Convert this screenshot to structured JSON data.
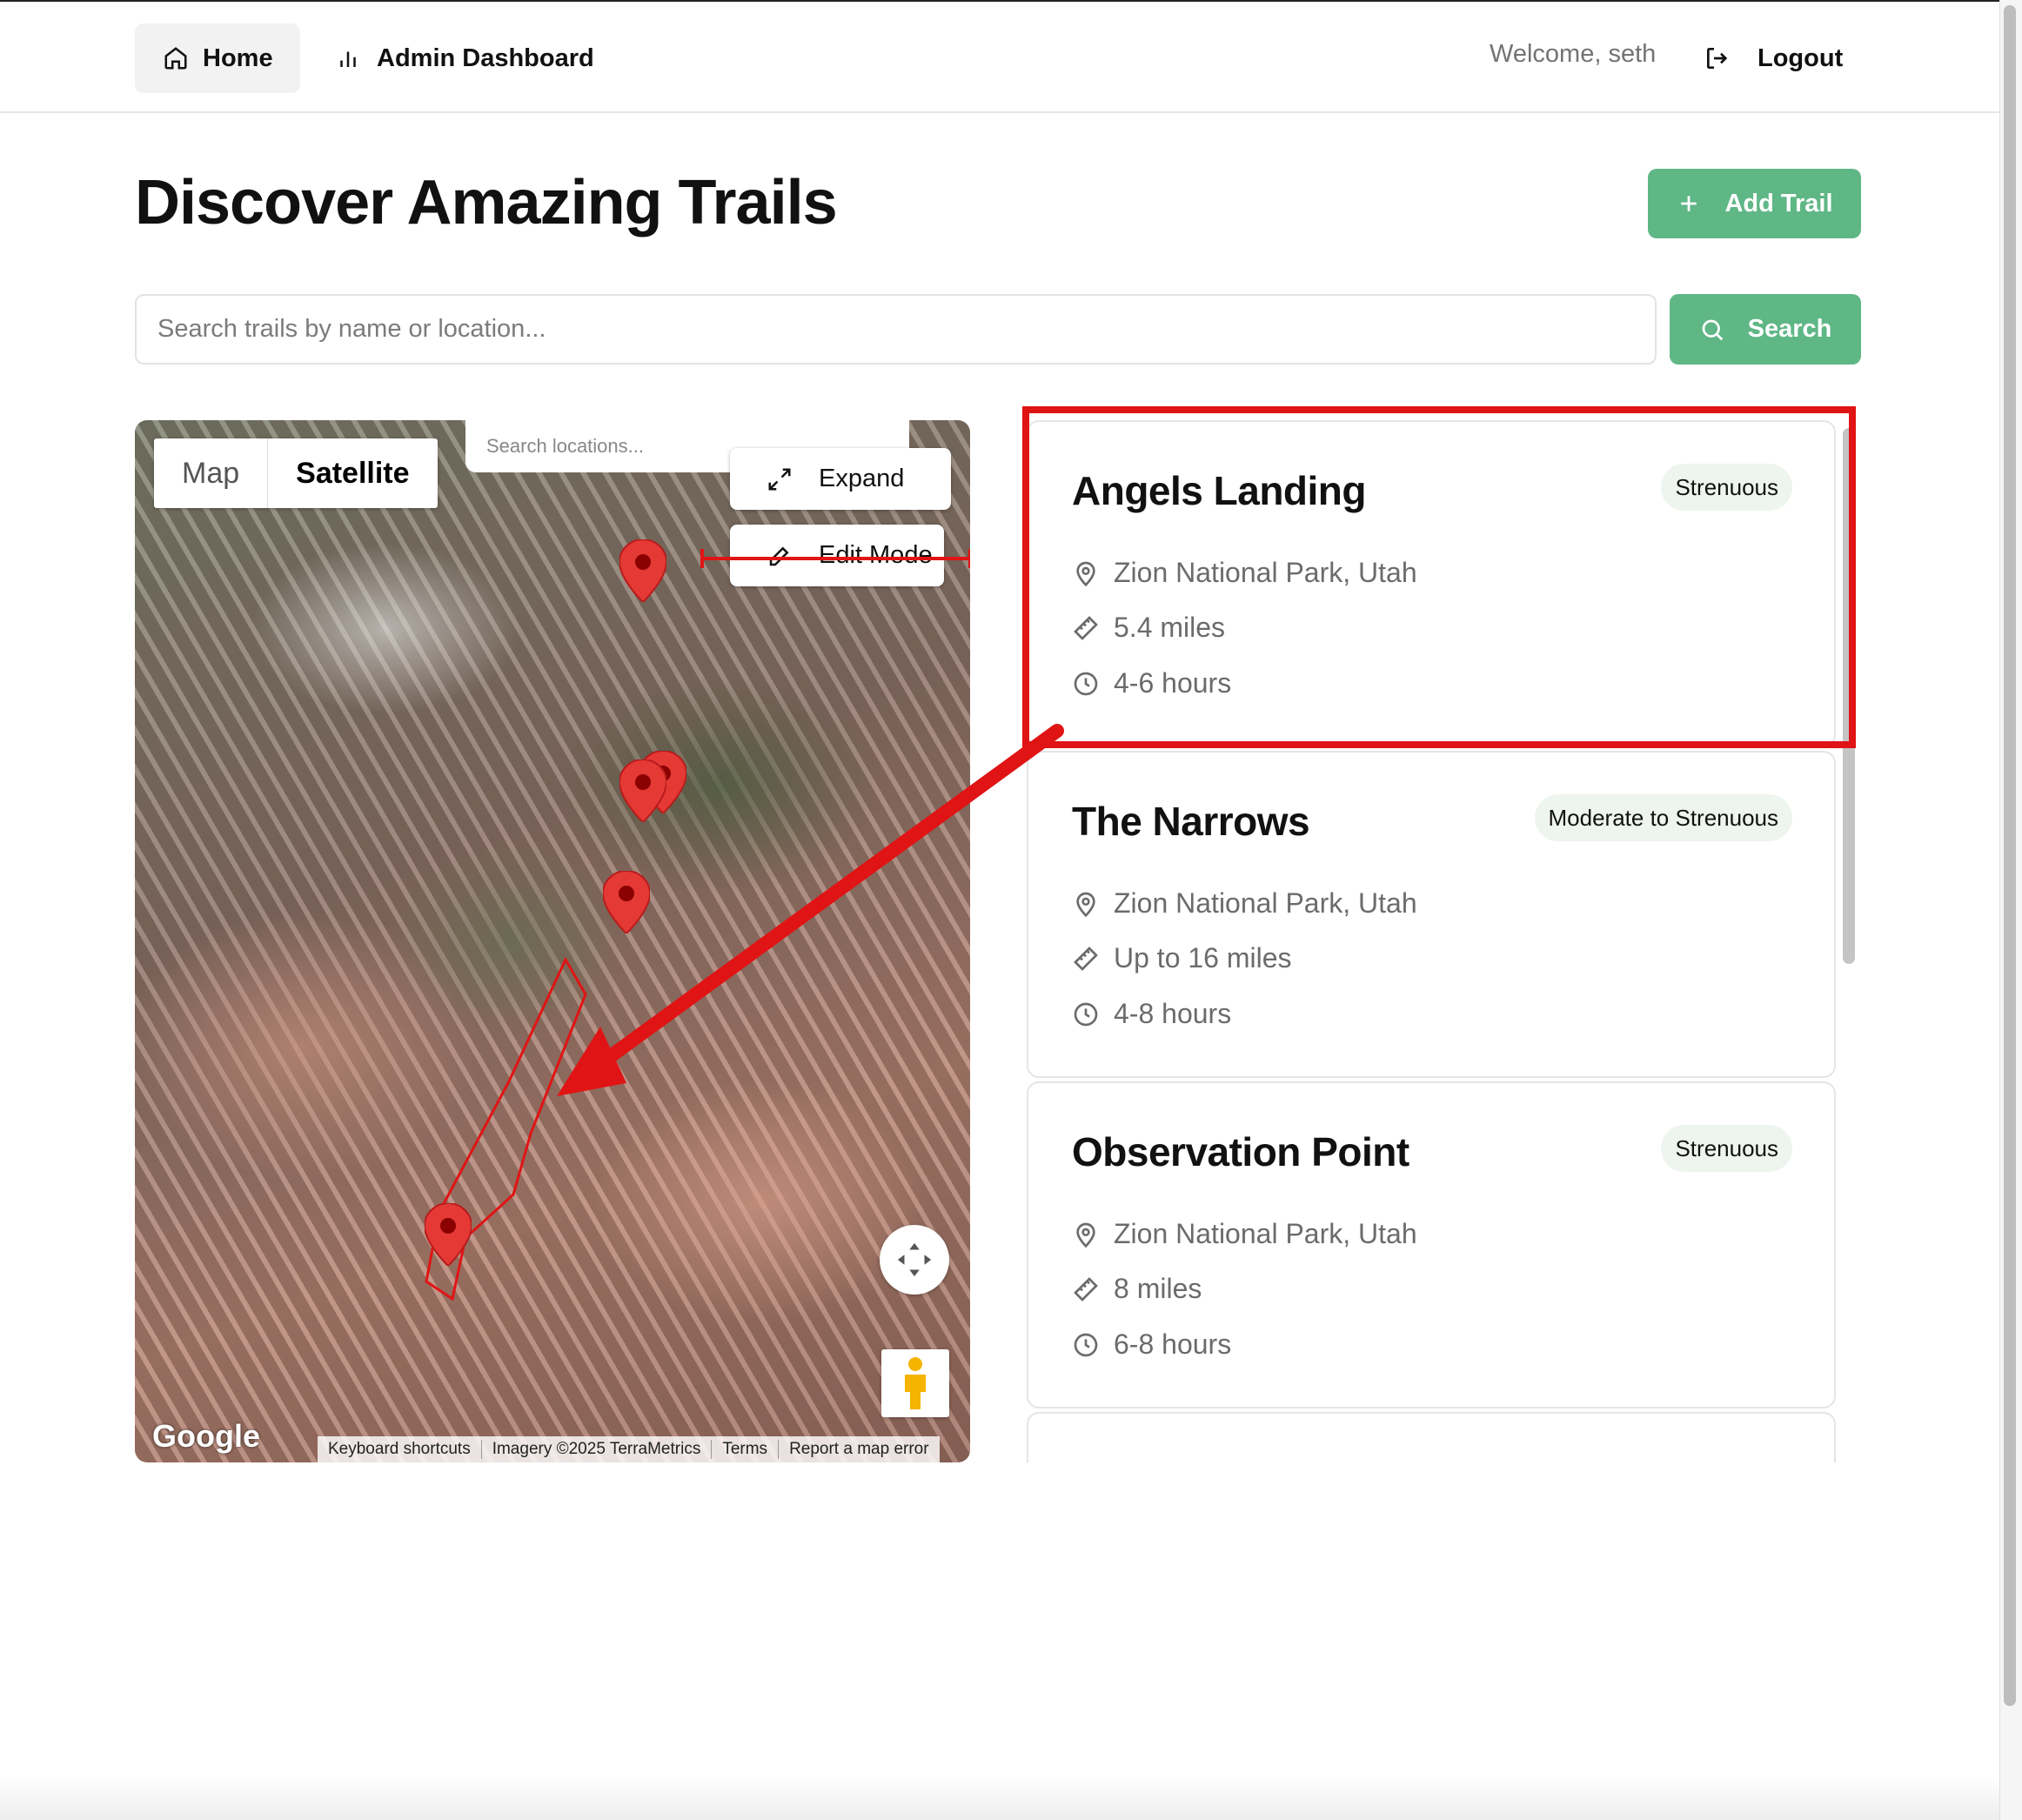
{
  "nav": {
    "home_label": "Home",
    "admin_label": "Admin Dashboard",
    "welcome_text": "Welcome, seth",
    "logout_label": "Logout"
  },
  "page": {
    "title": "Discover Amazing Trails",
    "add_trail_label": "Add Trail"
  },
  "search": {
    "placeholder": "Search trails by name or location...",
    "value": "",
    "button_label": "Search"
  },
  "map": {
    "type_map_label": "Map",
    "type_satellite_label": "Satellite",
    "selected_type": "Satellite",
    "search_placeholder": "Search locations...",
    "expand_label": "Expand",
    "edit_mode_label": "Edit Mode",
    "logo_text": "Google",
    "attribution": [
      "Keyboard shortcuts",
      "Imagery ©2025 TerraMetrics",
      "Terms",
      "Report a map error"
    ]
  },
  "trails": [
    {
      "name": "Angels Landing",
      "difficulty": "Strenuous",
      "location": "Zion National Park, Utah",
      "distance": "5.4 miles",
      "duration": "4-6 hours"
    },
    {
      "name": "The Narrows",
      "difficulty": "Moderate to Strenuous",
      "location": "Zion National Park, Utah",
      "distance": "Up to 16 miles",
      "duration": "4-8 hours"
    },
    {
      "name": "Observation Point",
      "difficulty": "Strenuous",
      "location": "Zion National Park, Utah",
      "distance": "8 miles",
      "duration": "6-8 hours"
    }
  ],
  "colors": {
    "accent": "#5fb785",
    "badge_bg": "#eef5ef",
    "annotation_red": "#e01414"
  },
  "icons": [
    "home-icon",
    "bar-chart-icon",
    "logout-icon",
    "plus-icon",
    "search-icon",
    "expand-icon",
    "pencil-icon",
    "map-pin-icon",
    "ruler-icon",
    "clock-icon",
    "recenter-icon",
    "pegman-icon"
  ]
}
